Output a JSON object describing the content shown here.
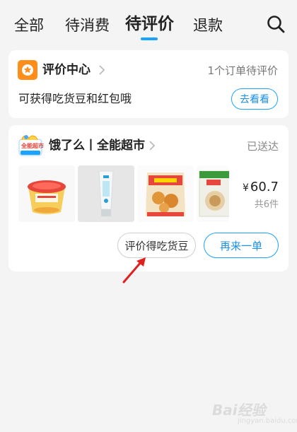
{
  "tabs": [
    {
      "label": "全部",
      "active": false
    },
    {
      "label": "待消费",
      "active": false
    },
    {
      "label": "待评价",
      "active": true
    },
    {
      "label": "退款",
      "active": false
    }
  ],
  "header": {
    "search_icon": "search-icon",
    "accent_color": "#1aa3ff"
  },
  "eval_center": {
    "title": "评价中心",
    "pending": "1个订单待评价",
    "description": "可获得吃货豆和红包哦",
    "button": "去看看",
    "logo_color": "#ff8d1a"
  },
  "order": {
    "store_logo_text": "全能超市",
    "store_name": "饿了么丨全能超市",
    "status": "已送达",
    "items": [
      "pudding-cup",
      "toothpaste-tube",
      "snack-bag",
      "biscuit-pack"
    ],
    "price_symbol": "¥",
    "price": "60.7",
    "count": "共6件",
    "review_button": "评价得吃货豆",
    "reorder_button": "再来一单"
  },
  "watermark": {
    "text": "Bai经验",
    "sub": "jingyan.baidu.com"
  }
}
